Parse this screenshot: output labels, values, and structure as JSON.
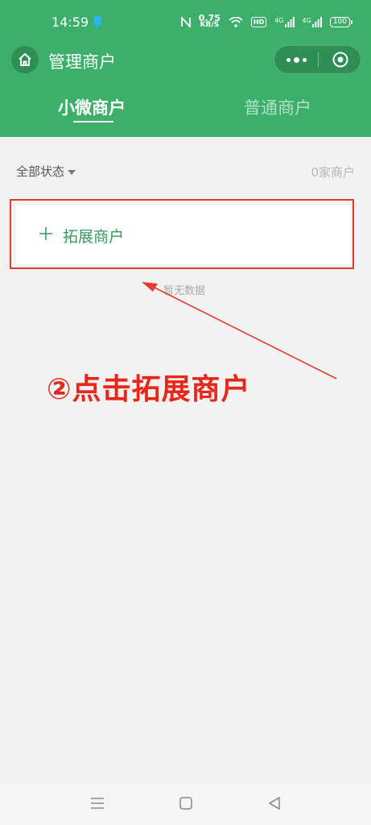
{
  "status_bar": {
    "time": "14:59",
    "speed_value": "0.75",
    "speed_unit": "KB/S",
    "hd_label": "HD",
    "net1": "4G",
    "net2": "4G",
    "battery": "100"
  },
  "navbar": {
    "title": "管理商户",
    "home_icon": "home-icon",
    "more_icon": "more-dots-icon",
    "close_icon": "target-close-icon"
  },
  "tabs": [
    {
      "label": "小微商户",
      "active": true
    },
    {
      "label": "普通商户",
      "active": false
    }
  ],
  "filter": {
    "status_label": "全部状态",
    "count_text": "0家商户"
  },
  "expand_button": {
    "label": "拓展商户",
    "icon": "plus-icon"
  },
  "empty_text": "暂无数据",
  "annotation": {
    "text": "②点击拓展商户",
    "color": "#e8271b"
  },
  "bottom_nav": {
    "menu_icon": "menu-icon",
    "home_icon": "square-home-icon",
    "back_icon": "back-triangle-icon"
  },
  "colors": {
    "brand_green": "#3cb06b",
    "annotation_red": "#e8392e"
  }
}
